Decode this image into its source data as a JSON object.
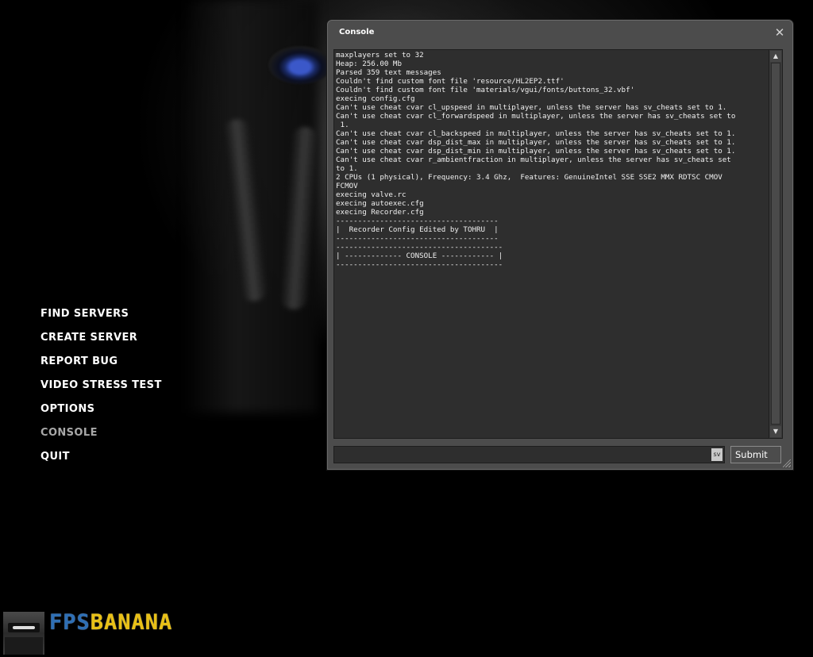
{
  "main_menu": {
    "items": [
      {
        "label": "FIND SERVERS"
      },
      {
        "label": "CREATE SERVER"
      },
      {
        "label": "REPORT BUG"
      },
      {
        "label": "VIDEO STRESS TEST"
      },
      {
        "label": "OPTIONS"
      },
      {
        "label": "CONSOLE"
      },
      {
        "label": "QUIT"
      }
    ]
  },
  "logo": {
    "text_part1": "FPS",
    "text_part2": "BANANA",
    "color_part1": "#2e6fb5",
    "color_part2": "#e8c016"
  },
  "console": {
    "title": "Console",
    "close_glyph": "✕",
    "output_lines": [
      "maxplayers set to 32",
      "Heap: 256.00 Mb",
      "Parsed 359 text messages",
      "Couldn't find custom font file 'resource/HL2EP2.ttf'",
      "Couldn't find custom font file 'materials/vgui/fonts/buttons_32.vbf'",
      "execing config.cfg",
      "Can't use cheat cvar cl_upspeed in multiplayer, unless the server has sv_cheats set to 1.",
      "Can't use cheat cvar cl_forwardspeed in multiplayer, unless the server has sv_cheats set to",
      " 1.",
      "Can't use cheat cvar cl_backspeed in multiplayer, unless the server has sv_cheats set to 1.",
      "Can't use cheat cvar dsp_dist_max in multiplayer, unless the server has sv_cheats set to 1.",
      "Can't use cheat cvar dsp_dist_min in multiplayer, unless the server has sv_cheats set to 1.",
      "Can't use cheat cvar r_ambientfraction in multiplayer, unless the server has sv_cheats set",
      "to 1.",
      "2 CPUs (1 physical), Frequency: 3.4 Ghz,  Features: GenuineIntel SSE SSE2 MMX RDTSC CMOV",
      "FCMOV",
      "execing valve.rc",
      "execing autoexec.cfg",
      "execing Recorder.cfg",
      "-------------------------------------",
      "|  Recorder Config Edited by TOHRU  |",
      "-------------------------------------",
      "--------------------------------------",
      "| ------------- CONSOLE ------------ |",
      "--------------------------------------"
    ],
    "input_value": "",
    "input_chip": "sv",
    "submit_label": "Submit",
    "scroll_up_glyph": "▲",
    "scroll_down_glyph": "▼"
  }
}
